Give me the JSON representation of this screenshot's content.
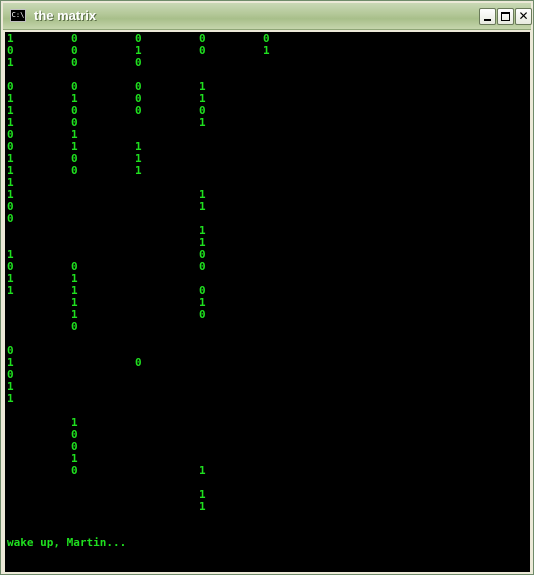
{
  "window": {
    "title": "the matrix",
    "icon_label": "C:\\"
  },
  "console": {
    "text_color": "#1fe01f",
    "background": "#000000",
    "columns": [
      "1\n0\n1\n\n0\n1\n1\n1\n0\n0\n1\n1\n1\n1\n0\n0\n\n\n1\n0\n1\n1\n\n\n\n\n0\n1\n0\n1\n1",
      "0\n0\n0\n\n0\n1\n0\n0\n1\n1\n0\n0\n\n\n\n\n\n\n\n0\n1\n1\n1\n1\n0\n\n\n\n\n\n\n\n1\n0\n0\n1\n0",
      "0\n1\n0\n\n0\n0\n0\n\n\n1\n1\n1\n\n\n\n\n\n\n\n\n\n\n\n\n\n\n\n0",
      "0\n0\n\n\n1\n1\n0\n1\n\n\n\n\n\n1\n1\n\n1\n1\n0\n0\n\n0\n1\n0\n\n\n\n\n\n\n\n\n\n\n\n\n1\n\n1\n1",
      "0\n1"
    ],
    "message": "wake up, Martin..."
  }
}
